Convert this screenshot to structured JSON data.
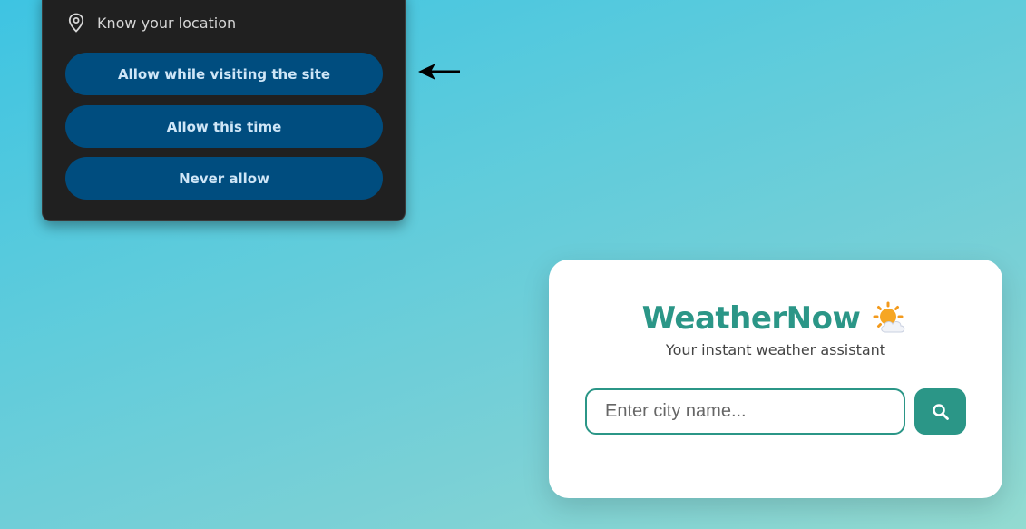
{
  "permission_popup": {
    "prompt_text": "Know your location",
    "prompt_icon": "location-pin-icon",
    "buttons": {
      "allow_while_visiting": "Allow while visiting the site",
      "allow_this_time": "Allow this time",
      "never_allow": "Never allow"
    },
    "button_color": "#004d7f",
    "background_color": "#202020"
  },
  "annotation": {
    "icon": "left-arrow-icon"
  },
  "app": {
    "title": "WeatherNow",
    "title_icon": "sun-behind-cloud-icon",
    "subtitle": "Your instant weather assistant",
    "search": {
      "placeholder": "Enter city name...",
      "value": "",
      "button_icon": "search-icon"
    },
    "accent_color": "#2b9687"
  }
}
